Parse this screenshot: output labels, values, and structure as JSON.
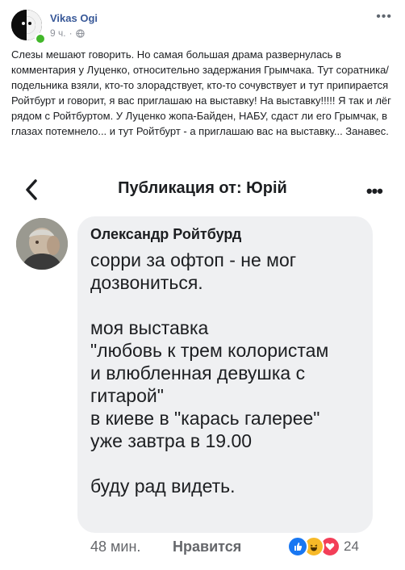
{
  "post": {
    "author": "Vikas Ogi",
    "time": "9 ч.",
    "text": "Слезы мешают говорить. Но самая большая драма развернулась в комментария у Луценко, относительно задержания Грымчака. Тут соратника/подельника взяли, кто-то злорадствует, кто-то сочувствует и тут припирается Ройтбурт и говорит, я вас приглашаю на выставку! На выставку!!!!! Я так и лёг рядом с Ройтбуртом. У Луценко жопа-Байден, НАБУ, сдаст ли его Грымчак, в глазах потемнело... и тут Ройтбурт - а приглашаю вас на выставку... Занавес."
  },
  "screenshot": {
    "nav_title": "Публикация от: Юрій",
    "comment": {
      "author": "Олександр Ройтбурд",
      "lines": [
        "сорри за офтоп - не мог",
        "дозвониться.",
        "",
        "моя выставка",
        "\"любовь к трем колористам",
        "и влюбленная девушка с",
        "гитарой\"",
        "в киеве в \"карась галерее\"",
        "уже завтра в 19.00",
        "",
        "буду рад видеть."
      ],
      "time": "48 мин.",
      "like_label": "Нравится",
      "reaction_count": "24",
      "reactions": [
        "like-icon",
        "haha-icon",
        "love-icon"
      ]
    }
  },
  "colors": {
    "author_link": "#385898",
    "bubble_bg": "#eff0f2",
    "online": "#42b72a",
    "like": "#1877f2",
    "haha": "#f7b928",
    "love": "#f33e58"
  }
}
